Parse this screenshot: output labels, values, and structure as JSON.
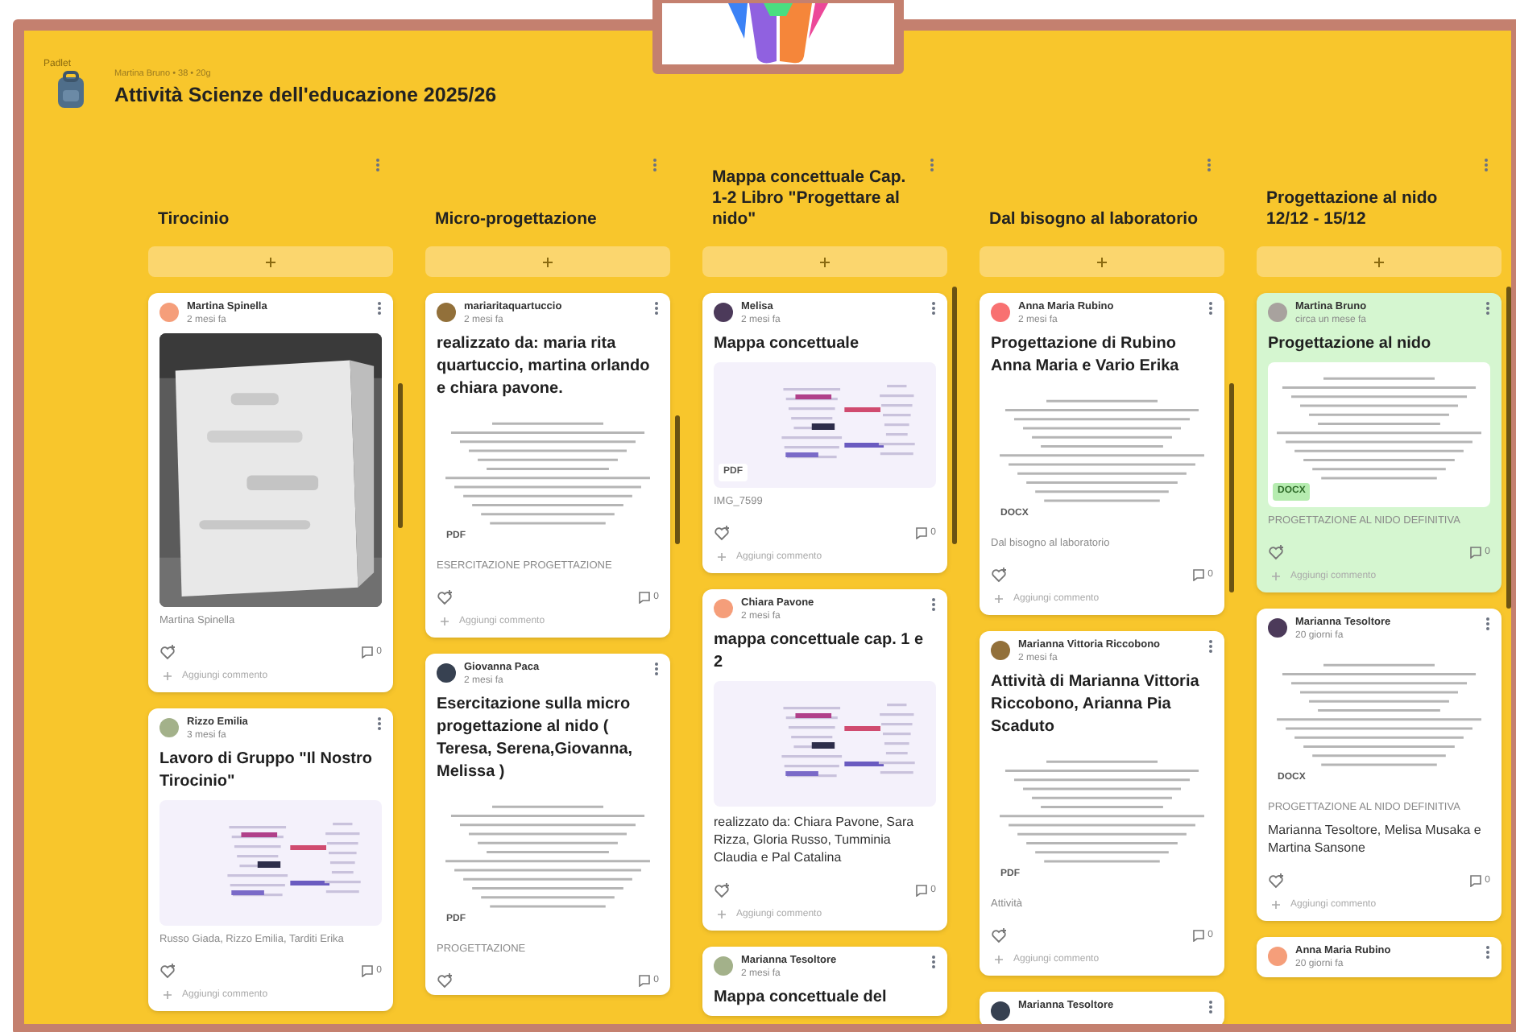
{
  "app": {
    "name": "Padlet"
  },
  "board": {
    "byline": "Martina Bruno • 38 • 20g",
    "title": "Attività Scienze dell'educazione 2025/26"
  },
  "columns": [
    {
      "title": "Tirocinio",
      "cards": [
        {
          "author": "Martina Spinella",
          "time": "2 mesi fa",
          "attachment_title": "Martina Spinella",
          "comments": "0",
          "comment_placeholder": "Aggiungi commento",
          "highlighted": false
        },
        {
          "author": "Rizzo Emilia",
          "time": "3 mesi fa",
          "title": "Lavoro di Gruppo \"Il Nostro Tirocinio\"",
          "attachment": {
            "kind": "diagram"
          },
          "attachment_title": "Russo Giada, Rizzo Emilia, Tarditi Erika",
          "comments": "0",
          "comment_placeholder": "Aggiungi commento",
          "highlighted": false
        }
      ]
    },
    {
      "title": "Micro-progettazione",
      "cards": [
        {
          "author": "mariaritaquartuccio",
          "time": "2 mesi fa",
          "title": "realizzato da: maria rita quartuccio, martina orlando e chiara pavone.",
          "attachment": {
            "kind": "document",
            "badge": "PDF"
          },
          "attachment_title": "ESERCITAZIONE PROGETTAZIONE",
          "comments": "0",
          "comment_placeholder": "Aggiungi commento",
          "highlighted": false
        },
        {
          "author": "Giovanna Paca",
          "time": "2 mesi fa",
          "title": "Esercitazione sulla micro progettazione al nido ( Teresa, Serena,Giovanna, Melissa )",
          "attachment": {
            "kind": "document",
            "badge": "PDF"
          },
          "attachment_title": "PROGETTAZIONE",
          "comments": "0",
          "highlighted": false
        }
      ]
    },
    {
      "title": "Mappa concettuale Cap. 1-2 Libro \"Progettare al nido\"",
      "cards": [
        {
          "author": "Melisa",
          "time": "2 mesi fa",
          "title": "Mappa concettuale",
          "attachment": {
            "kind": "diagram",
            "badge": "PDF"
          },
          "attachment_title": "IMG_7599",
          "comments": "0",
          "comment_placeholder": "Aggiungi commento",
          "highlighted": false
        },
        {
          "author": "Chiara Pavone",
          "time": "2 mesi fa",
          "title": "mappa concettuale cap. 1 e 2",
          "attachment": {
            "kind": "diagram"
          },
          "body": "realizzato da: Chiara Pavone, Sara Rizza, Gloria Russo, Tumminia Claudia e Pal Catalina",
          "comments": "0",
          "comment_placeholder": "Aggiungi commento",
          "highlighted": false
        },
        {
          "author": "Marianna Tesoltore",
          "time": "2 mesi fa",
          "title": "Mappa concettuale del",
          "highlighted": false
        }
      ]
    },
    {
      "title": "Dal bisogno al laboratorio",
      "cards": [
        {
          "author": "Anna Maria Rubino",
          "time": "2 mesi fa",
          "title": "Progettazione di Rubino Anna Maria e Vario Erika",
          "attachment": {
            "kind": "document",
            "badge": "DOCX"
          },
          "attachment_title": "Dal bisogno al laboratorio",
          "comments": "0",
          "comment_placeholder": "Aggiungi commento",
          "highlighted": false
        },
        {
          "author": "Marianna Vittoria Riccobono",
          "time": "2 mesi fa",
          "title": "Attività di Marianna Vittoria Riccobono, Arianna Pia Scaduto",
          "attachment": {
            "kind": "document",
            "badge": "PDF"
          },
          "attachment_title": "Attività",
          "comments": "0",
          "comment_placeholder": "Aggiungi commento",
          "highlighted": false
        },
        {
          "author": "Marianna Tesoltore",
          "highlighted": false
        }
      ]
    },
    {
      "title": "Progettazione al nido 12/12 - 15/12",
      "cards": [
        {
          "author": "Martina Bruno",
          "time": "circa un mese fa",
          "title": "Progettazione al nido",
          "attachment": {
            "kind": "document",
            "badge": "DOCX"
          },
          "attachment_title": "PROGETTAZIONE AL NIDO DEFINITIVA",
          "comments": "0",
          "comment_placeholder": "Aggiungi commento",
          "highlighted": true
        },
        {
          "author": "Marianna Tesoltore",
          "time": "20 giorni fa",
          "attachment": {
            "kind": "document",
            "badge": "DOCX"
          },
          "attachment_title": "PROGETTAZIONE AL NIDO DEFINITIVA",
          "body": "Marianna Tesoltore, Melisa Musaka e Martina Sansone",
          "comments": "0",
          "comment_placeholder": "Aggiungi commento",
          "highlighted": false
        },
        {
          "author": "Anna Maria Rubino",
          "time": "20 giorni fa",
          "highlighted": false
        }
      ]
    }
  ]
}
